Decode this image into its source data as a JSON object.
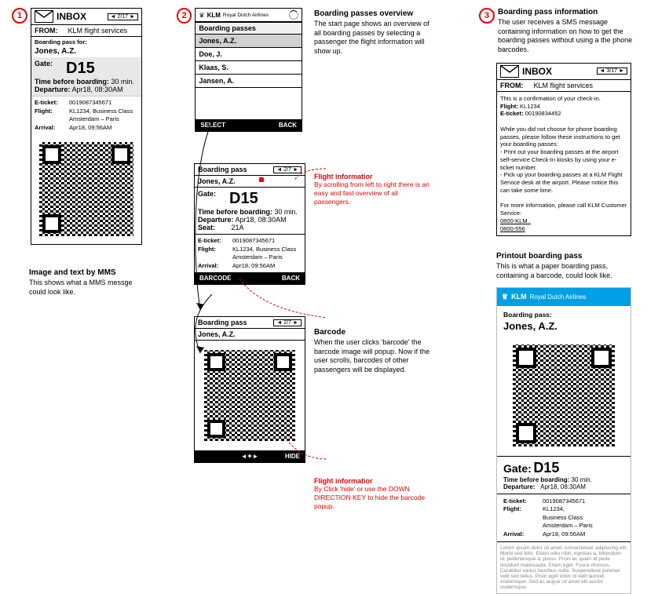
{
  "steps": {
    "s1": "1",
    "s2": "2",
    "s3": "3"
  },
  "mms": {
    "inbox_title": "INBOX",
    "pager": "2/17",
    "from_label": "FROM:",
    "from_value": "KLM flight services",
    "bp_for_label": "Boarding pass for:",
    "passenger": "Jones, A.Z.",
    "gate_label": "Gate:",
    "gate": "D15",
    "tbb_label": "Time before boarding:",
    "tbb_value": "30 min.",
    "dep_label": "Departure:",
    "dep_value": "Apr18, 08:30AM",
    "eticket_label": "E-ticket:",
    "eticket_value": "0019087345671",
    "flight_label": "Flight:",
    "flight_value": "KL1234, Business Class",
    "route": "Amsterdam – Paris",
    "arr_label": "Arrival:",
    "arr_value": "Apr18, 09:56AM"
  },
  "mms_desc": {
    "title": "Image and text by MMS",
    "body": "This shows what a MMS messge could look like."
  },
  "overview": {
    "brand": "KLM",
    "brand_sub": "Royal Dutch Airlines",
    "section": "Boarding passes",
    "names": [
      "Jones, A.Z.",
      "Doe, J.",
      "Klaas, S.",
      "Jansen, A."
    ],
    "select": "SELECT",
    "back": "BACK"
  },
  "overview_desc": {
    "title": "Boarding passes overview",
    "body": "The start page shows an overview of all boarding passes by selecting a passenger the flight information will show up."
  },
  "bp": {
    "section": "Boarding pass",
    "pager": "2/7",
    "name": "Jones, A.Z.",
    "gate_label": "Gate:",
    "gate": "D15",
    "tbb_label": "Time before boarding:",
    "tbb_value": "30 min.",
    "dep_label": "Departure:",
    "dep_value": "Apr18, 08:30AM",
    "seat_label": "Seat:",
    "seat_value": "21A",
    "eticket_label": "E-ticket:",
    "eticket_value": "0019087345671",
    "flight_label": "Flight:",
    "flight_value": "KL1234, Business Class",
    "route": "Amsterdam – Paris",
    "arr_label": "Arrival:",
    "arr_value": "Apr18, 09:56AM",
    "barcode_btn": "BARCODE",
    "back_btn": "BACK"
  },
  "bp_red": {
    "title": "Flight informatior",
    "body": "By scrolling from left to right there is an easy and fast overview of all passengers."
  },
  "barcode_view": {
    "section": "Boarding pass",
    "pager": "2/7",
    "name": "Jones, A.Z.",
    "hide_btn": "HIDE"
  },
  "barcode_desc": {
    "title": "Barcode",
    "body": "When the user clicks 'barcode' the barcode image will popup. Now if the user scrolls, barcodes of other passengers will be displayed."
  },
  "barcode_red": {
    "title": "Flight informatior",
    "body": "By Click 'hide' or use the DOWN DIRECTION KEY to hide the barcode popup."
  },
  "sms_desc": {
    "title": "Boarding pass information",
    "body": "The user receives a SMS message containing information on how to get the boarding passes without using a the phone barcodes."
  },
  "sms": {
    "inbox_title": "INBOX",
    "pager": "3/17",
    "from_label": "FROM:",
    "from_value": "KLM flight services",
    "line1": "This is a confirmation of your check-in.",
    "line2_label": "Flight:",
    "line2_value": "KL1234",
    "line3_label": "E-ticket:",
    "line3_value": "00190834452",
    "para1": "While you did not choose for phone boarding passes, please follow these instructions to get your boarding passes:",
    "bullet1": "- Print out your boarding passes at the airport self-service Check-In kiosks by using your e-ticket number.",
    "bullet2": "- Pick up your boarding passes at a KLM Flight Service desk at the airport. Please notice this can take some time.",
    "para2": "For more information, please call KLM Customer Service:",
    "phone1": "0800-KLM",
    "phone2": "0800-556"
  },
  "printout_desc": {
    "title": "Printout boarding pass",
    "body": "This is what a paper boarding pass, containing a barcode, could look like."
  },
  "printout": {
    "brand": "KLM",
    "brand_sub": "Royal Dutch Airlines",
    "bp_label": "Boarding pass:",
    "name": "Jones, A.Z.",
    "gate_label": "Gate:",
    "gate": "D15",
    "tbb_label": "Time before boarding:",
    "tbb_value": "30 min.",
    "dep_label": "Departure:",
    "dep_value": "Apr18, 08:30AM",
    "eticket_label": "E-ticket:",
    "eticket_value": "0019087345671",
    "flight_label": "Flight:",
    "flight_value": "KL1234,",
    "flight_value2": "Business Class",
    "route": "Amsterdam – Paris",
    "arr_label": "Arrival:",
    "arr_value": "Apr18, 09:56AM",
    "fineprint": "Lorem ipsum dolor sit amet, consectetuer adipiscing elit. Morbi sed felis. Etiam odio nibh, egestas a, bibendum id, pellentesque a, purus. Proin ac quam at pede tincidunt malesuada. Etiam eget. Fusce rhoncus. Curabitur varius faucibus nulla. Suspendisse pulvinar velit sed tellus. Proin eget dolor id velit laoreet scelerisque. Sed ac augue sit amet elit auctor scelerisque."
  }
}
